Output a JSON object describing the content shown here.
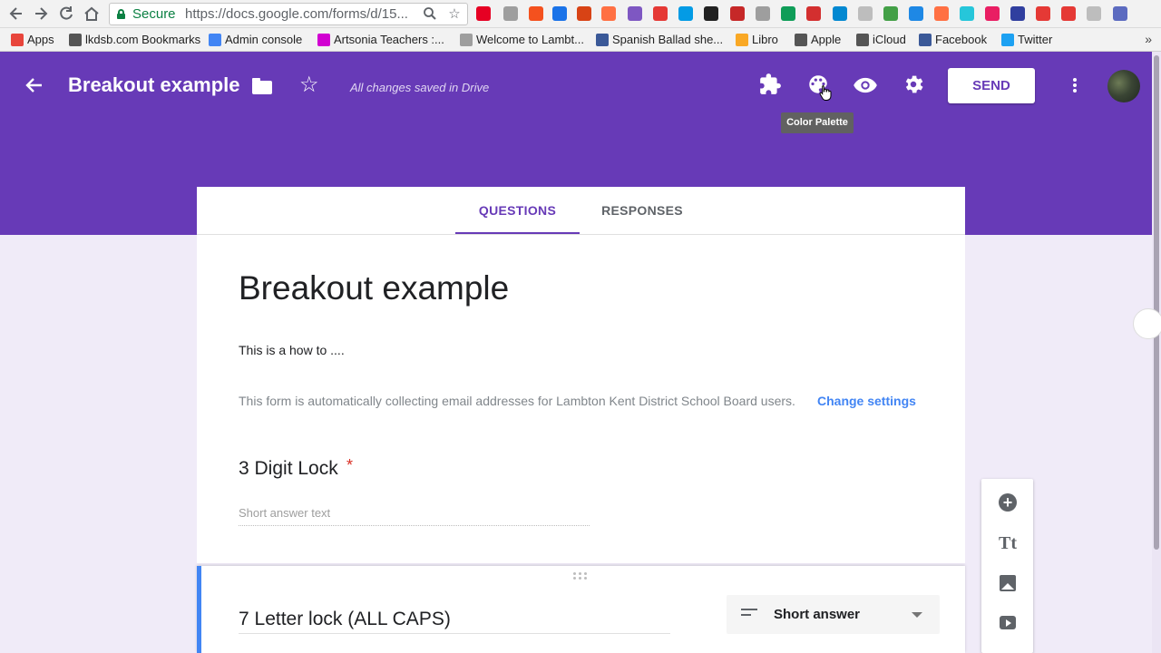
{
  "browser": {
    "secure_label": "Secure",
    "url": "https://docs.google.com/forms/d/15...",
    "nav_icons": [
      "back-icon",
      "forward-icon",
      "reload-icon",
      "home-icon"
    ],
    "extension_colors": [
      "#e60023",
      "#9e9e9e",
      "#f4511e",
      "#1a73e8",
      "#d84315",
      "#ff7043",
      "#7e57c2",
      "#e53935",
      "#039be5",
      "#212121",
      "#c62828",
      "#9e9e9e",
      "#0f9d58",
      "#d32f2f",
      "#0288d1",
      "#bdbdbd",
      "#43a047",
      "#1e88e5",
      "#ff7043",
      "#26c6da",
      "#e91e63",
      "#303f9f",
      "#e53935",
      "#e53935",
      "#bdbdbd",
      "#5c6bc0"
    ]
  },
  "bookmarks": [
    {
      "label": "Apps",
      "color": "#e8453c"
    },
    {
      "label": "lkdsb.com Bookmarks",
      "color": "#555555"
    },
    {
      "label": "Admin console",
      "color": "#4285f4"
    },
    {
      "label": "Artsonia Teachers :...",
      "color": "#d100d1"
    },
    {
      "label": "Welcome to Lambt...",
      "color": "#9e9e9e"
    },
    {
      "label": "Spanish Ballad she...",
      "color": "#3b5998"
    },
    {
      "label": "Libro",
      "color": "#f9a825"
    },
    {
      "label": "Apple",
      "color": "#555555"
    },
    {
      "label": "iCloud",
      "color": "#555555"
    },
    {
      "label": "Facebook",
      "color": "#3b5998"
    },
    {
      "label": "Twitter",
      "color": "#1da1f2"
    }
  ],
  "bookmarks_more": "»",
  "header": {
    "back_glyph": "←",
    "title": "Breakout example",
    "star_glyph": "☆",
    "saved_status": "All changes saved in Drive",
    "send_label": "SEND",
    "tooltip": "Color Palette",
    "accent_color": "#673ab7"
  },
  "tabs": [
    {
      "label": "QUESTIONS",
      "active": true
    },
    {
      "label": "RESPONSES",
      "active": false
    }
  ],
  "form": {
    "title": "Breakout example",
    "description": "This is a how to ....",
    "email_note": "This form is automatically collecting email addresses for Lambton Kent District School Board users.",
    "change_settings": "Change settings"
  },
  "questions": [
    {
      "title": "3 Digit Lock",
      "required_mark": "*",
      "placeholder": "Short answer text"
    },
    {
      "title": "7 Letter lock (ALL CAPS)",
      "type": "Short answer"
    }
  ],
  "side_tools": {
    "add_glyph": "+",
    "title_glyph": "Tt"
  }
}
